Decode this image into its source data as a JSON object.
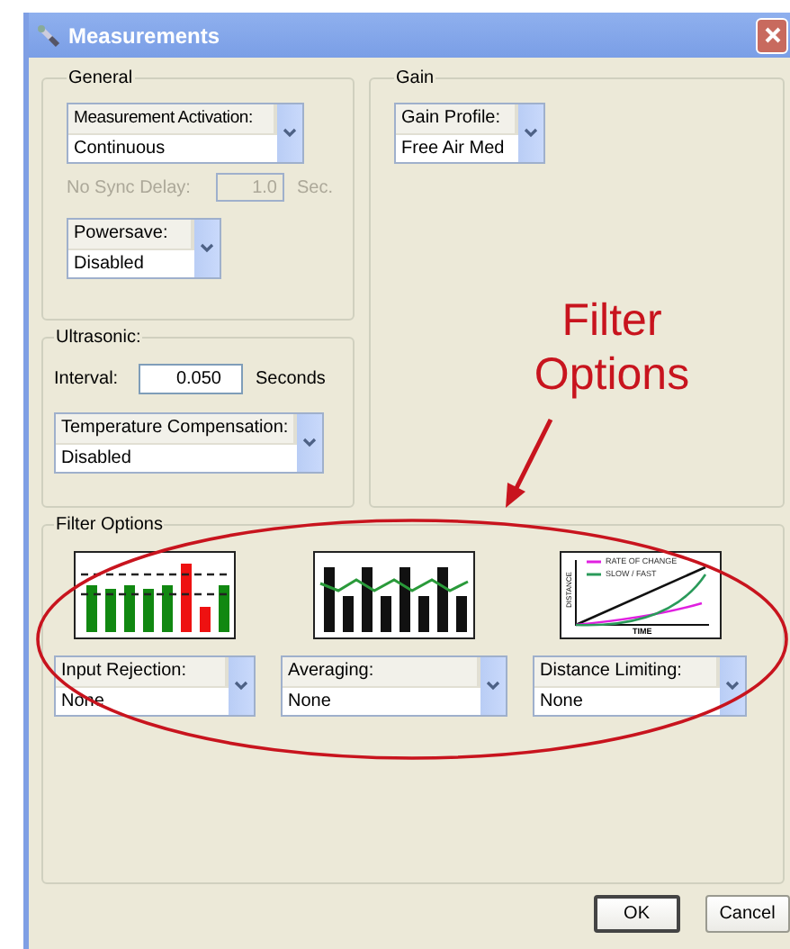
{
  "window": {
    "title": "Measurements"
  },
  "general": {
    "title": "General",
    "activation": {
      "label": "Measurement Activation:",
      "value": "Continuous"
    },
    "sync_delay": {
      "label": "No Sync Delay:",
      "value": "1.0",
      "unit": "Sec.",
      "disabled": true
    },
    "powersave": {
      "label": "Powersave:",
      "value": "Disabled"
    }
  },
  "gain": {
    "title": "Gain",
    "profile": {
      "label": "Gain Profile:",
      "value": "Free Air Med"
    }
  },
  "ultrasonic": {
    "title": "Ultrasonic:",
    "interval": {
      "label": "Interval:",
      "value": "0.050",
      "unit": "Seconds"
    },
    "temperature": {
      "label": "Temperature Compensation:",
      "value": "Disabled"
    }
  },
  "filter_options": {
    "title": "Filter Options",
    "filters": [
      {
        "kind": "rejection",
        "label": "Input Rejection:",
        "value": "None"
      },
      {
        "kind": "averaging",
        "label": "Averaging:",
        "value": "None"
      },
      {
        "kind": "limiting",
        "label": "Distance Limiting:",
        "value": "None",
        "legend": [
          "RATE OF CHANGE",
          "SLOW / FAST"
        ],
        "ylabel": "DISTANCE",
        "xlabel": "TIME"
      }
    ]
  },
  "buttons": [
    {
      "label": "OK",
      "default": true
    },
    {
      "label": "Cancel",
      "default": false
    }
  ],
  "annotation": {
    "text": "Filter Options"
  }
}
